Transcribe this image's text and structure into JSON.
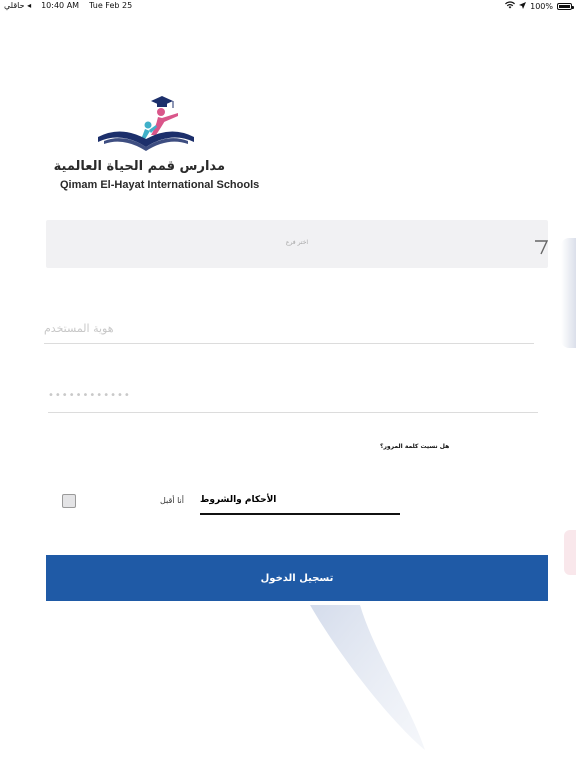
{
  "status_bar": {
    "carrier": "حاقلي ◂",
    "time": "10:40 AM",
    "date": "Tue Feb 25",
    "battery": "100%"
  },
  "logo": {
    "arabic_name": "مدارس قمم الحياة العالمية",
    "english_name": "Qimam El-Hayat International Schools"
  },
  "school_select": {
    "placeholder": "اختر فرع",
    "icon": "chevron-down-icon"
  },
  "username": {
    "placeholder": "هوية المستخدم"
  },
  "password": {
    "value": "••••••••••••"
  },
  "forgot_password": {
    "label": "هل نسيت كلمة المرور؟"
  },
  "terms": {
    "accept_label": "أنا أقبل",
    "link_label": "الأحكام والشروط"
  },
  "login_button": {
    "label": "تسجيل الدخول"
  },
  "colors": {
    "primary": "#1f5aa6",
    "input_bg": "#f1f1f3",
    "logo_navy": "#1c2f6b",
    "logo_pink": "#d9568a",
    "logo_teal": "#3fb0c9"
  }
}
